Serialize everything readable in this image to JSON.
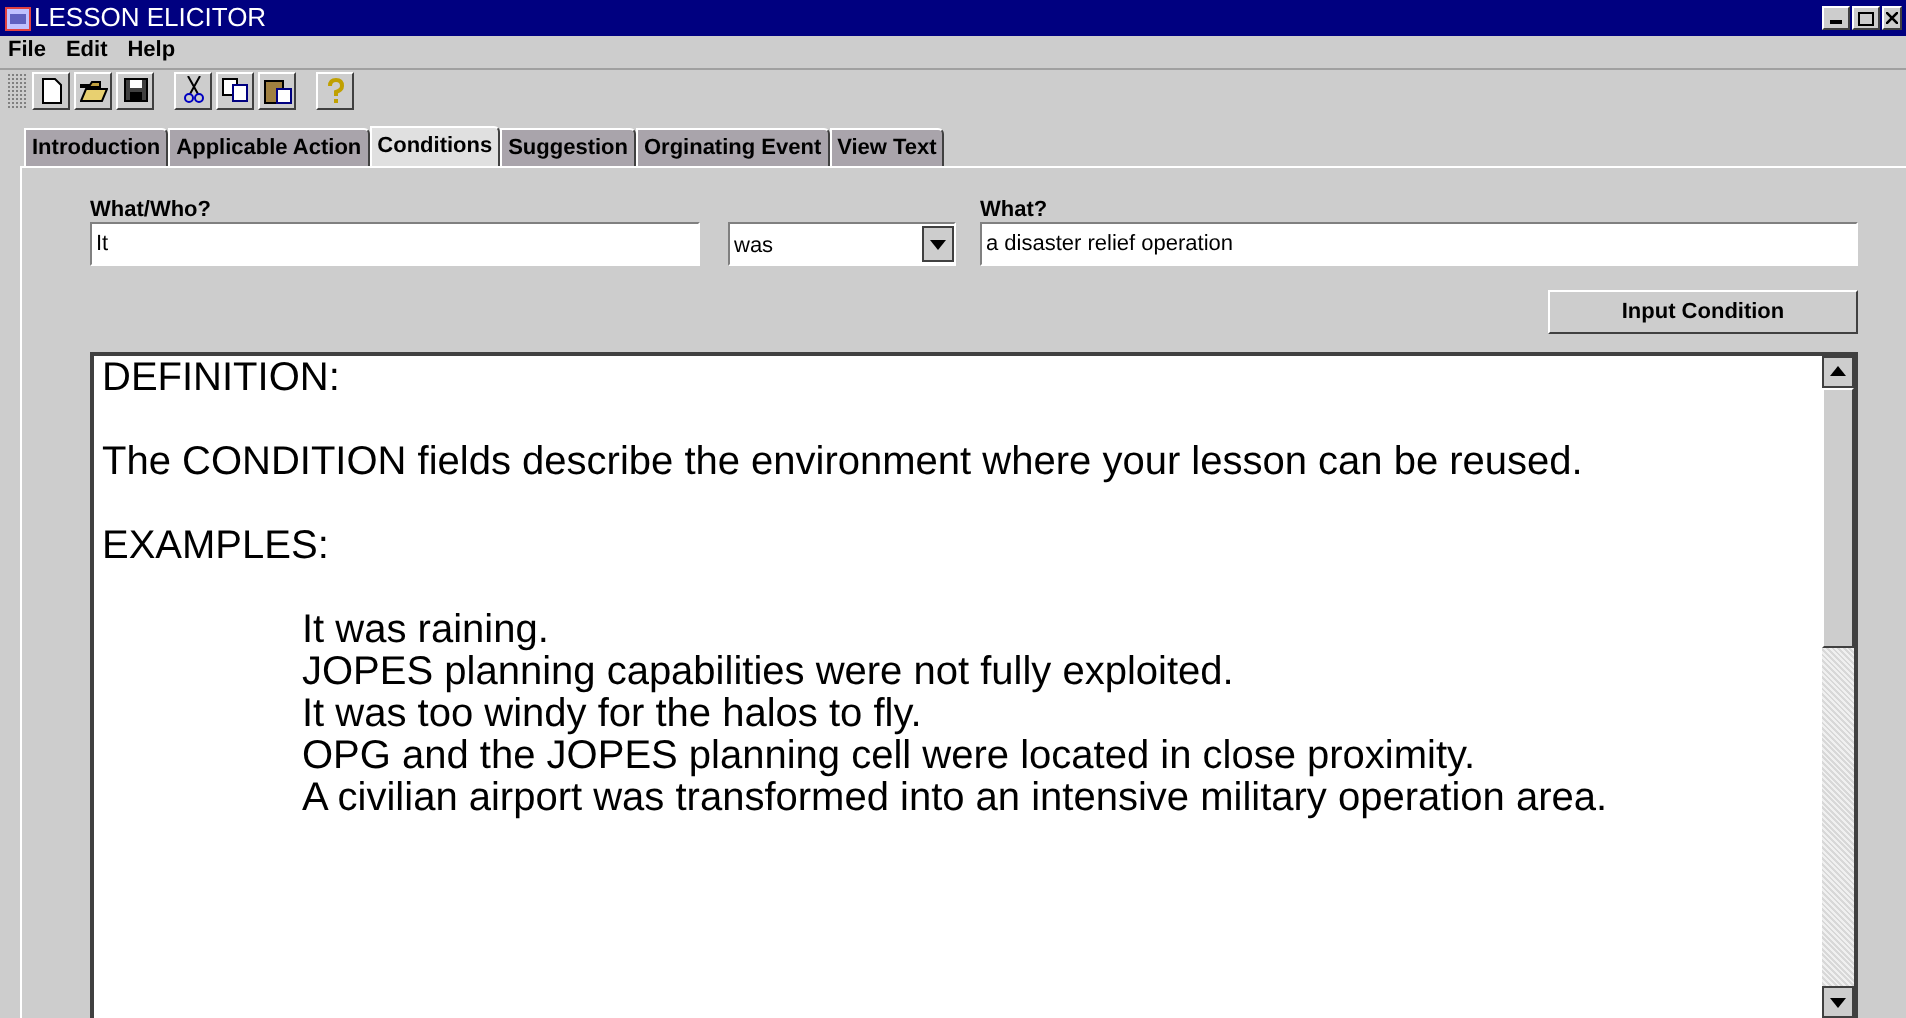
{
  "window": {
    "title": "LESSON ELICITOR"
  },
  "menu": [
    "File",
    "Edit",
    "Help"
  ],
  "tabs": [
    {
      "label": "Introduction",
      "selected": false
    },
    {
      "label": "Applicable Action",
      "selected": false
    },
    {
      "label": "Conditions",
      "selected": true
    },
    {
      "label": "Suggestion",
      "selected": false
    },
    {
      "label": "Orginating Event",
      "selected": false
    },
    {
      "label": "View Text",
      "selected": false
    }
  ],
  "form": {
    "who_label": "What/Who?",
    "who_value": "It",
    "verb_value": "was",
    "what_label": "What?",
    "what_value": "a disaster relief operation",
    "button": "Input Condition"
  },
  "text_area": {
    "lines": [
      {
        "text": "DEFINITION:",
        "kind": "heading"
      },
      {
        "text": "The CONDITION fields describe the environment where your lesson can be reused.",
        "kind": "paragraph"
      },
      {
        "text": "EXAMPLES:",
        "kind": "heading"
      },
      {
        "text": "It was raining.",
        "kind": "example"
      },
      {
        "text": "JOPES planning capabilities were not fully exploited.",
        "kind": "example"
      },
      {
        "text": "It was too windy for the halos to fly.",
        "kind": "example"
      },
      {
        "text": "OPG and the JOPES planning cell were located in close proximity.",
        "kind": "example"
      },
      {
        "text": "A civilian airport was transformed into an intensive military operation area.",
        "kind": "example"
      }
    ]
  }
}
